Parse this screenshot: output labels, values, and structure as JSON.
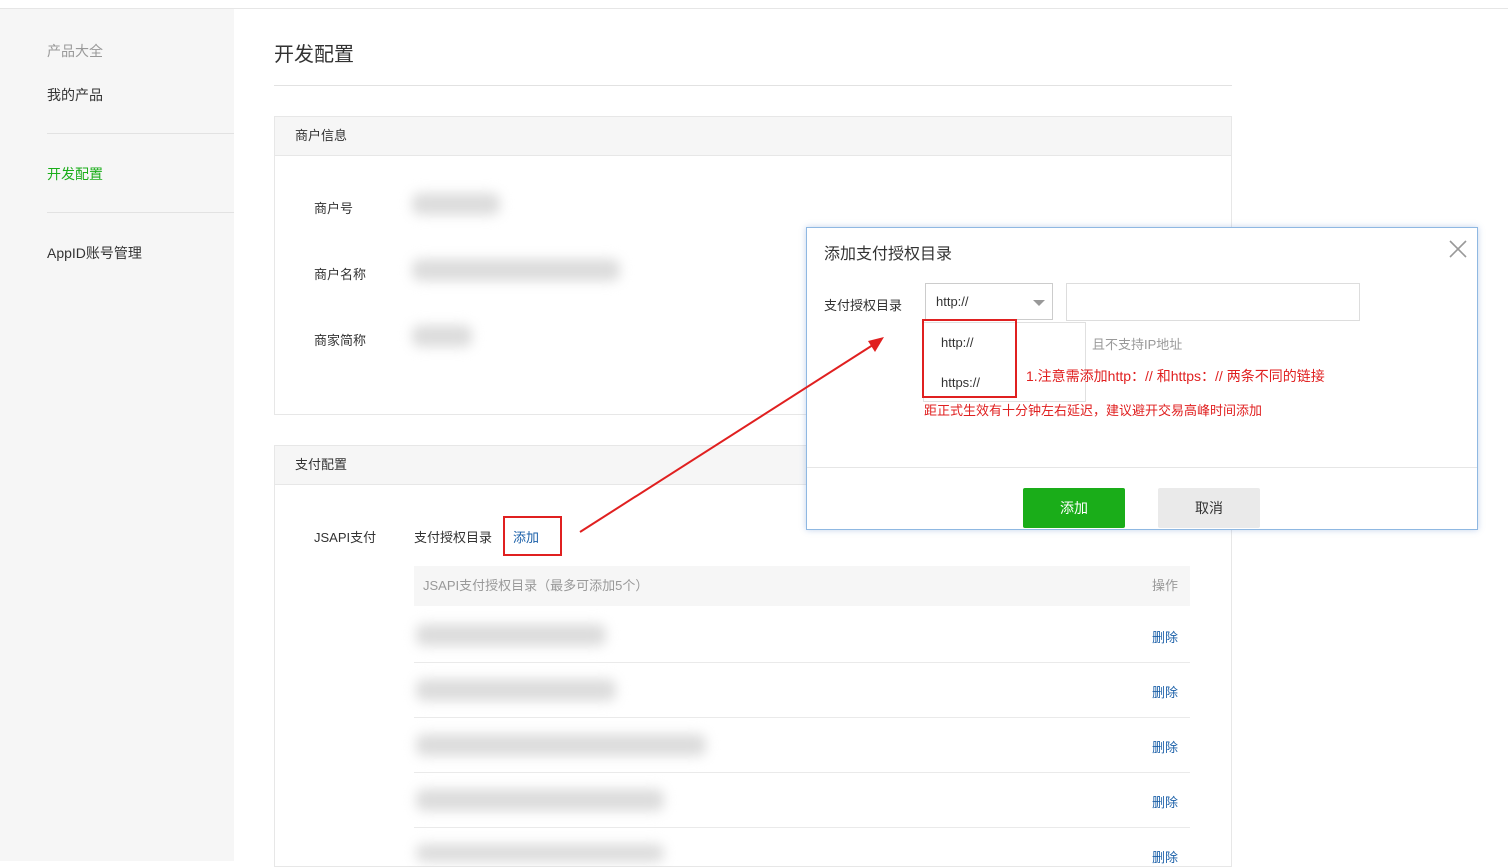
{
  "sidebar": {
    "heading": "产品大全",
    "items": [
      {
        "label": "我的产品"
      },
      {
        "label": "开发配置"
      },
      {
        "label": "AppID账号管理"
      }
    ]
  },
  "page": {
    "title": "开发配置"
  },
  "merchant": {
    "header": "商户信息",
    "fields": [
      {
        "label": "商户号"
      },
      {
        "label": "商户名称"
      },
      {
        "label": "商家简称"
      }
    ]
  },
  "pay_config": {
    "header": "支付配置",
    "jsapi_label": "JSAPI支付",
    "dir_label": "支付授权目录",
    "add_link": "添加",
    "table": {
      "col_dir": "JSAPI支付授权目录（最多可添加5个）",
      "col_op": "操作",
      "rows": [
        {
          "action": "删除"
        },
        {
          "action": "删除"
        },
        {
          "action": "删除"
        },
        {
          "action": "删除"
        },
        {
          "action": "删除"
        }
      ]
    }
  },
  "dialog": {
    "title": "添加支付授权目录",
    "field_label": "支付授权目录",
    "protocol_selected": "http://",
    "protocol_options": [
      "http://",
      "https://"
    ],
    "hint_partial": "且不支持IP地址",
    "warning": "距正式生效有十分钟左右延迟，建议避开交易高峰时间添加",
    "confirm_label": "添加",
    "cancel_label": "取消"
  },
  "annotation": {
    "note": "1.注意需添加http：// 和https：// 两条不同的链接",
    "color": "#e02020"
  },
  "colors": {
    "accent": "#1aad19",
    "link": "#1a5fa8"
  }
}
